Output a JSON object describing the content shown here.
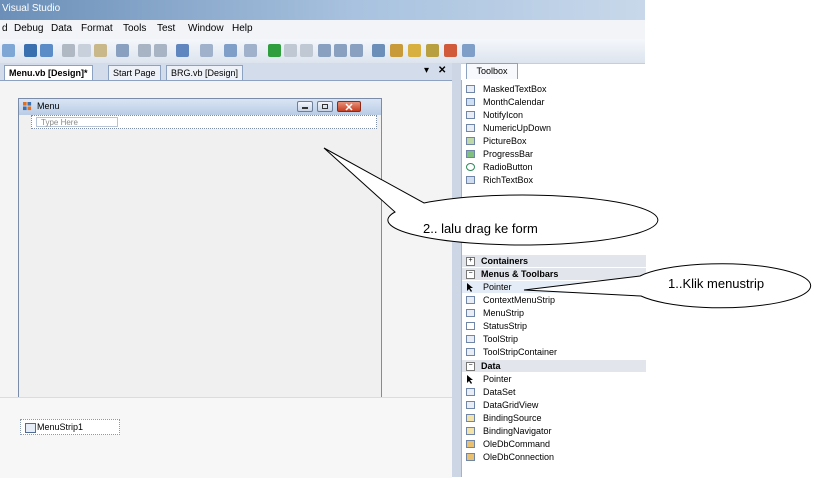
{
  "window": {
    "title": "Visual Studio"
  },
  "menu": {
    "items": [
      "d",
      "Debug",
      "Data",
      "Format",
      "Tools",
      "Test",
      "Window",
      "Help"
    ]
  },
  "tabs": [
    {
      "label": "Menu.vb [Design]*",
      "active": true
    },
    {
      "label": "Start Page",
      "active": false
    },
    {
      "label": "BRG.vb [Design]",
      "active": false
    }
  ],
  "tab_controls": {
    "dropdown": "▾",
    "close": "✕"
  },
  "form": {
    "title": "Menu",
    "type_here": "Type Here"
  },
  "tray": {
    "component": "MenuStrip1"
  },
  "toolbox": {
    "title": "Toolbox",
    "items_top": [
      "MaskedTextBox",
      "MonthCalendar",
      "NotifyIcon",
      "NumericUpDown",
      "PictureBox",
      "ProgressBar",
      "RadioButton",
      "RichTextBox"
    ],
    "category_containers": "Containers",
    "category_menus": "Menus & Toolbars",
    "items_menus": [
      "Pointer",
      "ContextMenuStrip",
      "MenuStrip",
      "StatusStrip",
      "ToolStrip",
      "ToolStripContainer"
    ],
    "category_data": "Data",
    "items_data": [
      "Pointer",
      "DataSet",
      "DataGridView",
      "BindingSource",
      "BindingNavigator",
      "OleDbCommand",
      "OleDbConnection"
    ],
    "selected": "Pointer"
  },
  "callouts": {
    "drag": "2.. lalu drag ke form",
    "click": "1..Klik menustrip"
  },
  "colors": {
    "title_gradient": "#6b8fb8",
    "accent": "#3169c6",
    "close_red": "#c53f23"
  }
}
